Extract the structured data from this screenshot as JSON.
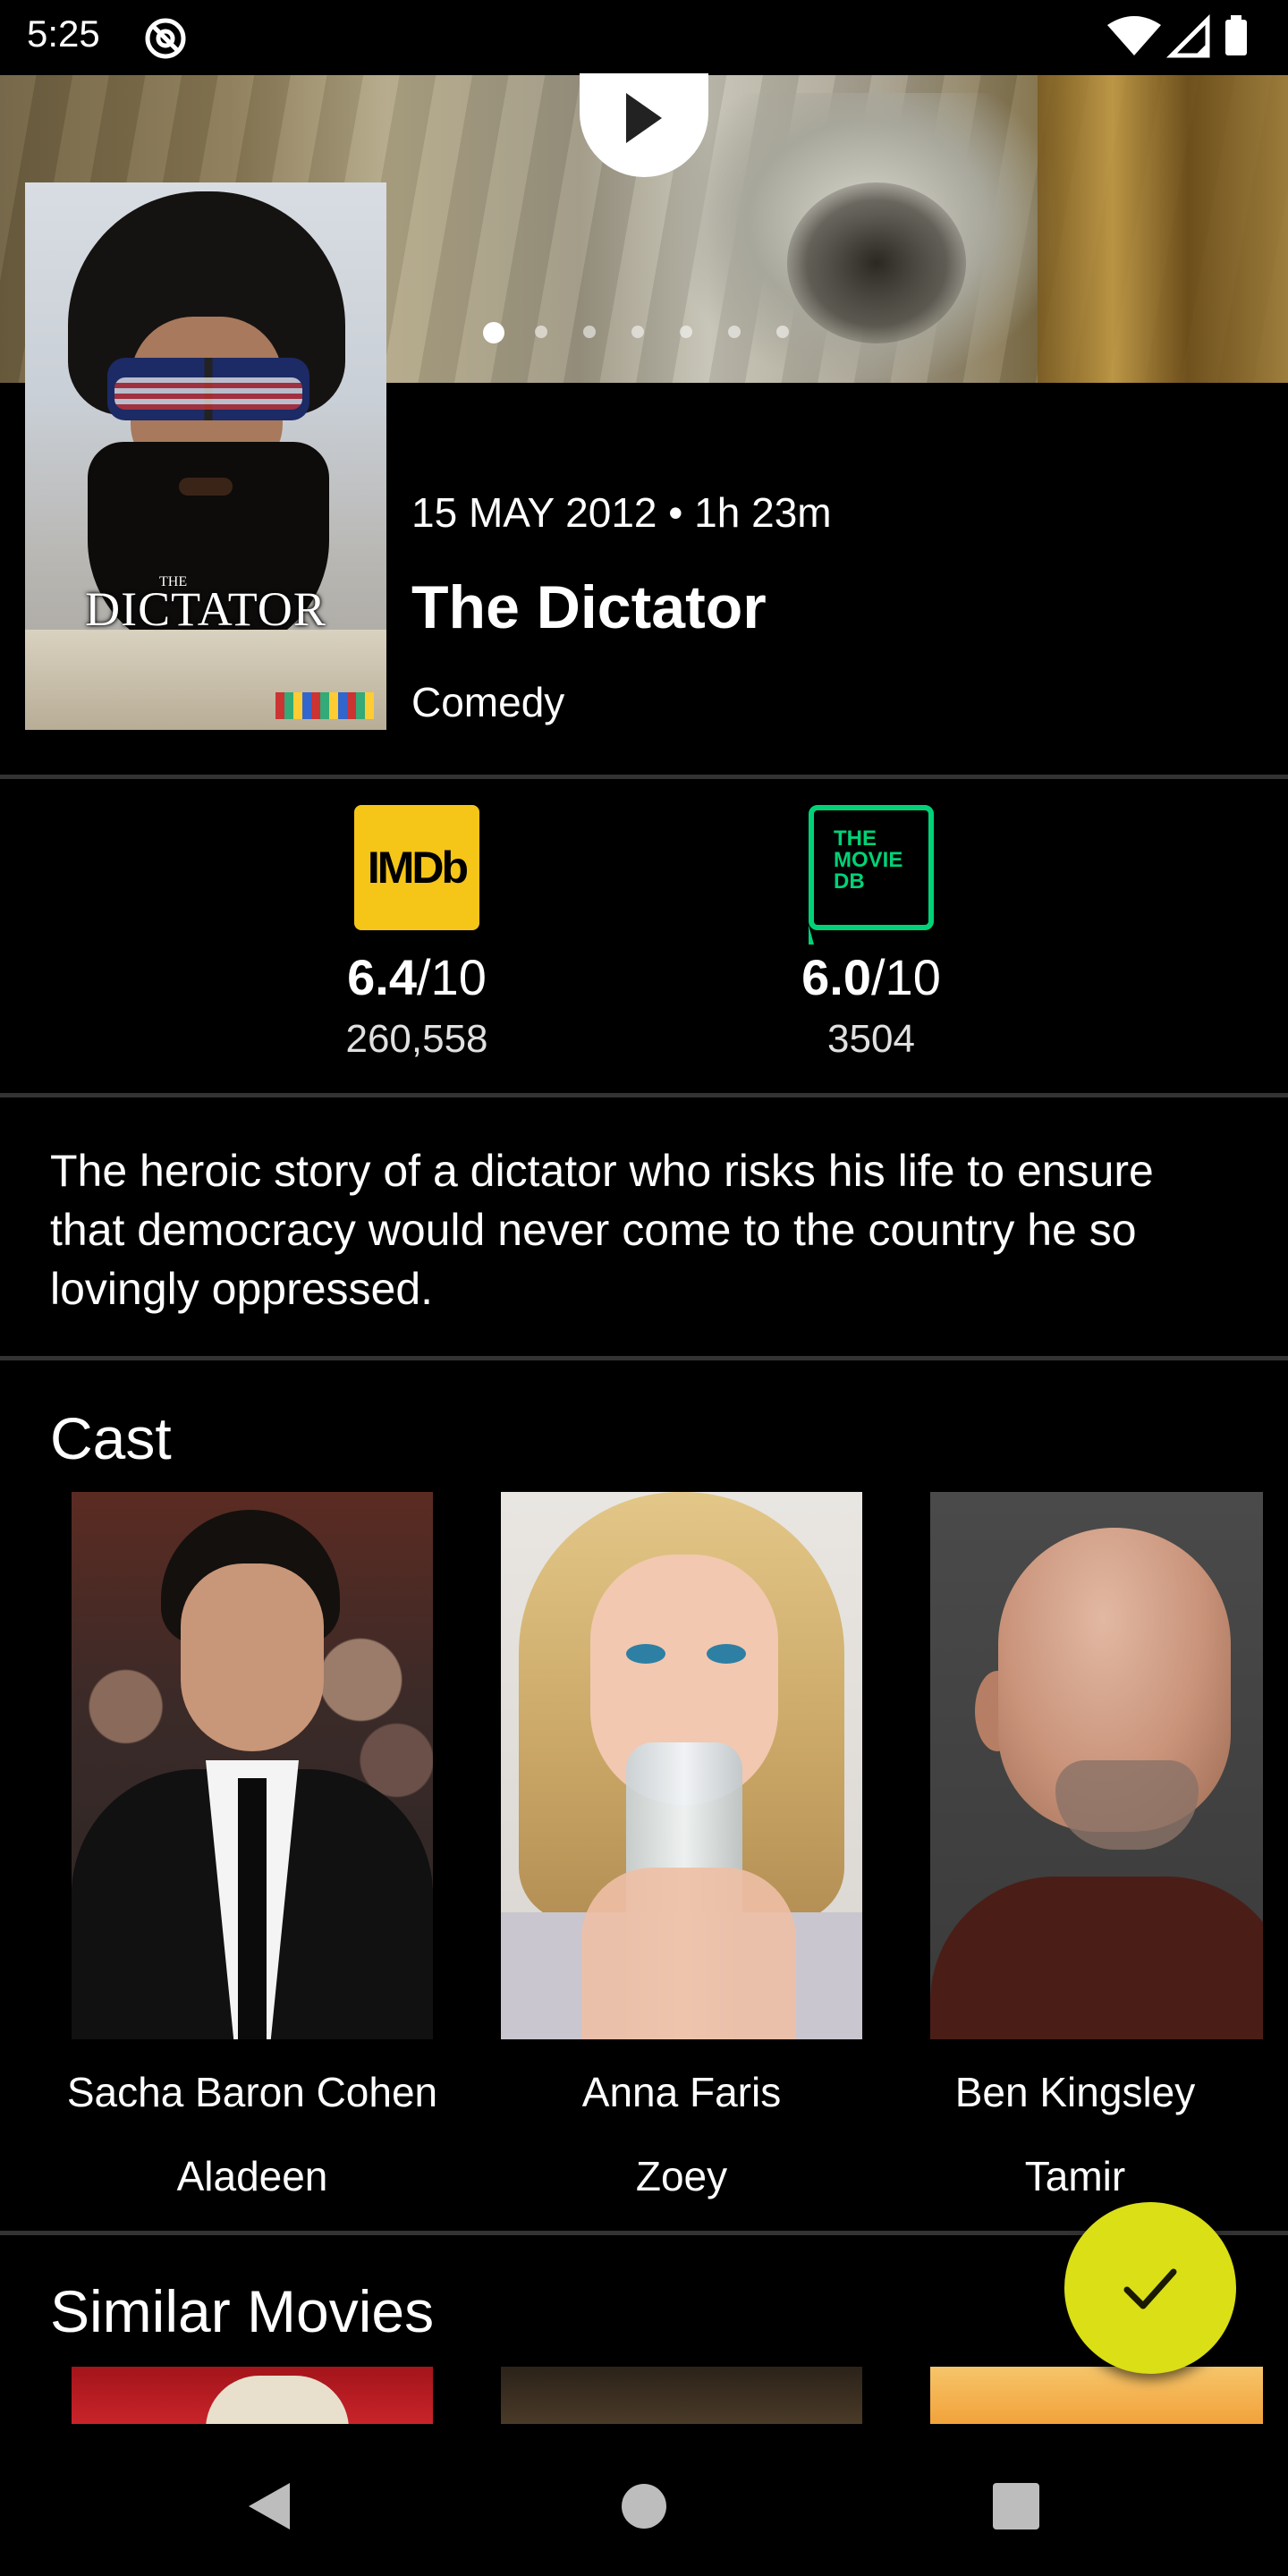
{
  "status_bar": {
    "time": "5:25",
    "app_icon": "at-sign-icon",
    "icons": [
      "wifi-icon",
      "signal-icon",
      "battery-icon"
    ]
  },
  "hero": {
    "play_icon": "play-icon",
    "carousel_total": 7,
    "carousel_active_index": 0
  },
  "poster": {
    "the": "THE",
    "title": "DICTATOR"
  },
  "movie": {
    "meta": "15 MAY 2012 • 1h 23m",
    "title": "The Dictator",
    "genre": "Comedy"
  },
  "ratings": {
    "imdb": {
      "logo_text": "IMDb",
      "score": "6.4",
      "scale": "/10",
      "votes": "260,558",
      "color": "#f5c518"
    },
    "tmdb": {
      "logo_text": "THE\nMOVIE\nDB",
      "score": "6.0",
      "scale": "/10",
      "votes": "3504",
      "color": "#01d277"
    }
  },
  "overview": "The heroic story of a dictator who risks his life to ensure that democracy would never come to the country he so lovingly oppressed.",
  "cast": {
    "title": "Cast",
    "members": [
      {
        "name": "Sacha Baron Cohen",
        "role": "Aladeen"
      },
      {
        "name": "Anna Faris",
        "role": "Zoey"
      },
      {
        "name": "Ben Kingsley",
        "role": "Tamir"
      }
    ]
  },
  "similar": {
    "title": "Similar Movies"
  },
  "fab": {
    "icon": "check-icon",
    "color": "#dadf16"
  },
  "nav": {
    "back": "back-icon",
    "home": "home-icon",
    "recents": "recents-icon"
  }
}
